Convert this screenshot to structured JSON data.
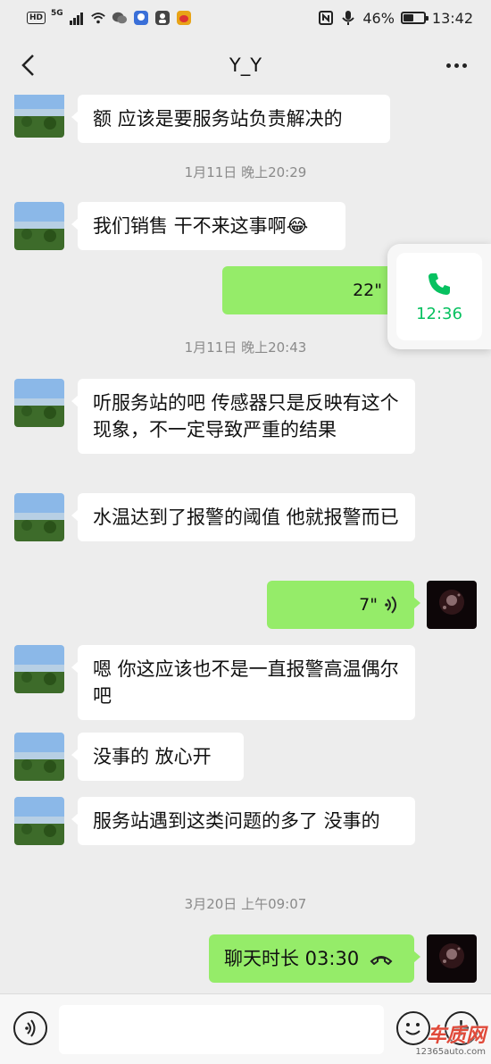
{
  "status_bar": {
    "hd": "HD",
    "network": "5G",
    "percent": "46%",
    "time": "13:42",
    "battery_level": 0.46
  },
  "header": {
    "title": "Y_Y"
  },
  "messages": {
    "m1": "额 应该是要服务站负责解决的",
    "ts1": "1月11日 晚上20:29",
    "m2": "我们销售 干不来这事啊",
    "v1": "22\"",
    "ts2": "1月11日 晚上20:43",
    "m3": "听服务站的吧 传感器只是反映有这个现象，不一定导致严重的结果",
    "m4": "水温达到了报警的阈值 他就报警而已",
    "v2": "7\"",
    "m5": "嗯 你这应该也不是一直报警高温偶尔吧",
    "m6": "没事的 放心开",
    "m7": "服务站遇到这类问题的多了 没事的",
    "ts3": "3月20日 上午09:07",
    "call": "聊天时长 03:30"
  },
  "watermark": "www.12365auto.com",
  "call_float": {
    "time": "12:36"
  },
  "logo": {
    "name": "车质网",
    "url": "12365auto.com"
  },
  "colors": {
    "outgoing_bubble": "#95ec69",
    "background": "#ededed",
    "accent_green": "#07c160"
  }
}
